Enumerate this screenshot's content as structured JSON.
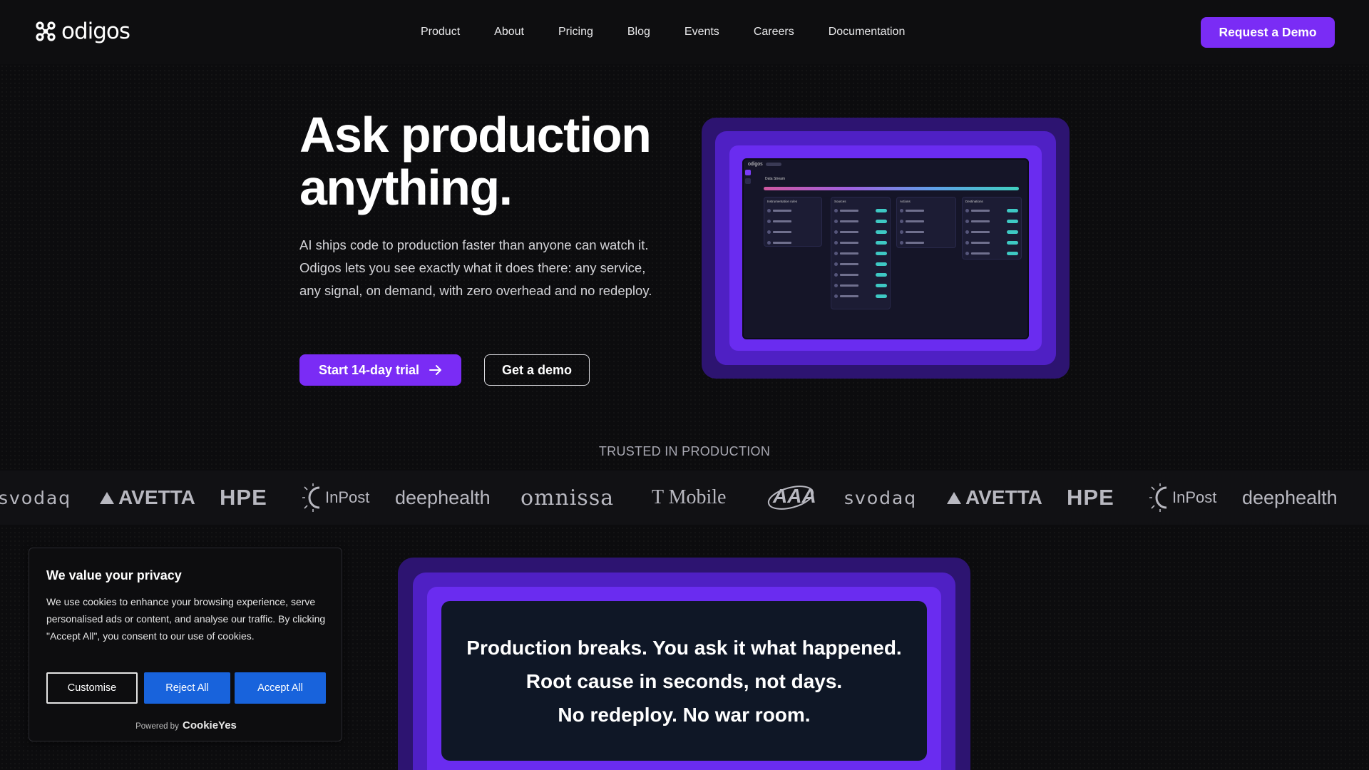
{
  "nav": {
    "logo_text": "odigos",
    "links": [
      "Product",
      "About",
      "Pricing",
      "Blog",
      "Events",
      "Careers",
      "Documentation"
    ],
    "cta": "Request a Demo"
  },
  "hero": {
    "title_line1": "Ask production",
    "title_line2": "anything.",
    "description": "AI ships code to production faster than anyone can watch it. Odigos lets you see exactly what it does there: any service, any signal, on demand, with zero overhead and no redeploy.",
    "primary_button": "Start 14-day trial",
    "secondary_button": "Get a demo",
    "screenshot": {
      "logo_text": "odigos",
      "stream_label": "Data Stream",
      "columns": [
        "Instrumentation rules",
        "Sources",
        "Actions",
        "Destinations"
      ]
    }
  },
  "trusted": {
    "heading": "TRUSTED IN PRODUCTION",
    "logos": [
      "svodaq",
      "AVETTA",
      "HPE",
      "InPost",
      "deephealth",
      "omnissa",
      "T Mobile",
      "AAA",
      "svodaq",
      "AVETTA",
      "HPE",
      "InPost",
      "deephealth"
    ]
  },
  "cookie": {
    "title": "We value your privacy",
    "text": "We use cookies to enhance your browsing experience, serve personalised ads or content, and analyse our traffic. By clicking \"Accept All\", you consent to our use of cookies.",
    "customise": "Customise",
    "reject": "Reject All",
    "accept": "Accept All",
    "powered_by": "Powered by",
    "brand": "CookieYes"
  },
  "statement": {
    "line1": "Production breaks. You ask it what happened.",
    "line2": "Root cause in seconds, not days.",
    "line3": "No redeploy. No war room."
  },
  "colors": {
    "accent": "#7a2cf5",
    "cookie_blue": "#1863dc",
    "frame_outer": "#2d1471",
    "frame_mid": "#4f20c4",
    "frame_inner": "#6a2cf0"
  }
}
